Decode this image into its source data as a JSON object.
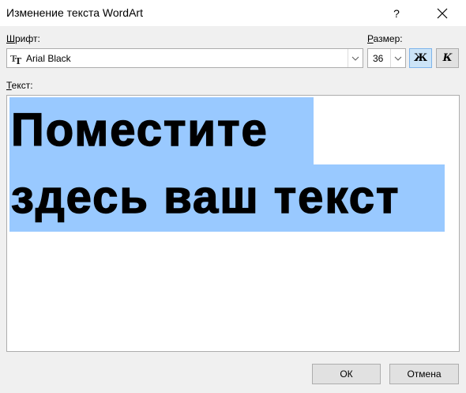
{
  "window": {
    "title": "Изменение текста WordArt",
    "help_label": "?",
    "close_icon": "close-icon"
  },
  "font": {
    "label_mnemonic": "Ш",
    "label_rest": "рифт:",
    "value": "Arial Black",
    "icon": "truetype-font-icon"
  },
  "size": {
    "label_mnemonic": "Р",
    "label_rest": "азмер:",
    "value": "36"
  },
  "format": {
    "bold_label": "Ж",
    "italic_label": "К"
  },
  "text": {
    "label_mnemonic": "Т",
    "label_rest": "екст:",
    "line1": "Поместите",
    "line2": "здесь ваш текст"
  },
  "buttons": {
    "ok": "ОК",
    "cancel": "Отмена"
  }
}
